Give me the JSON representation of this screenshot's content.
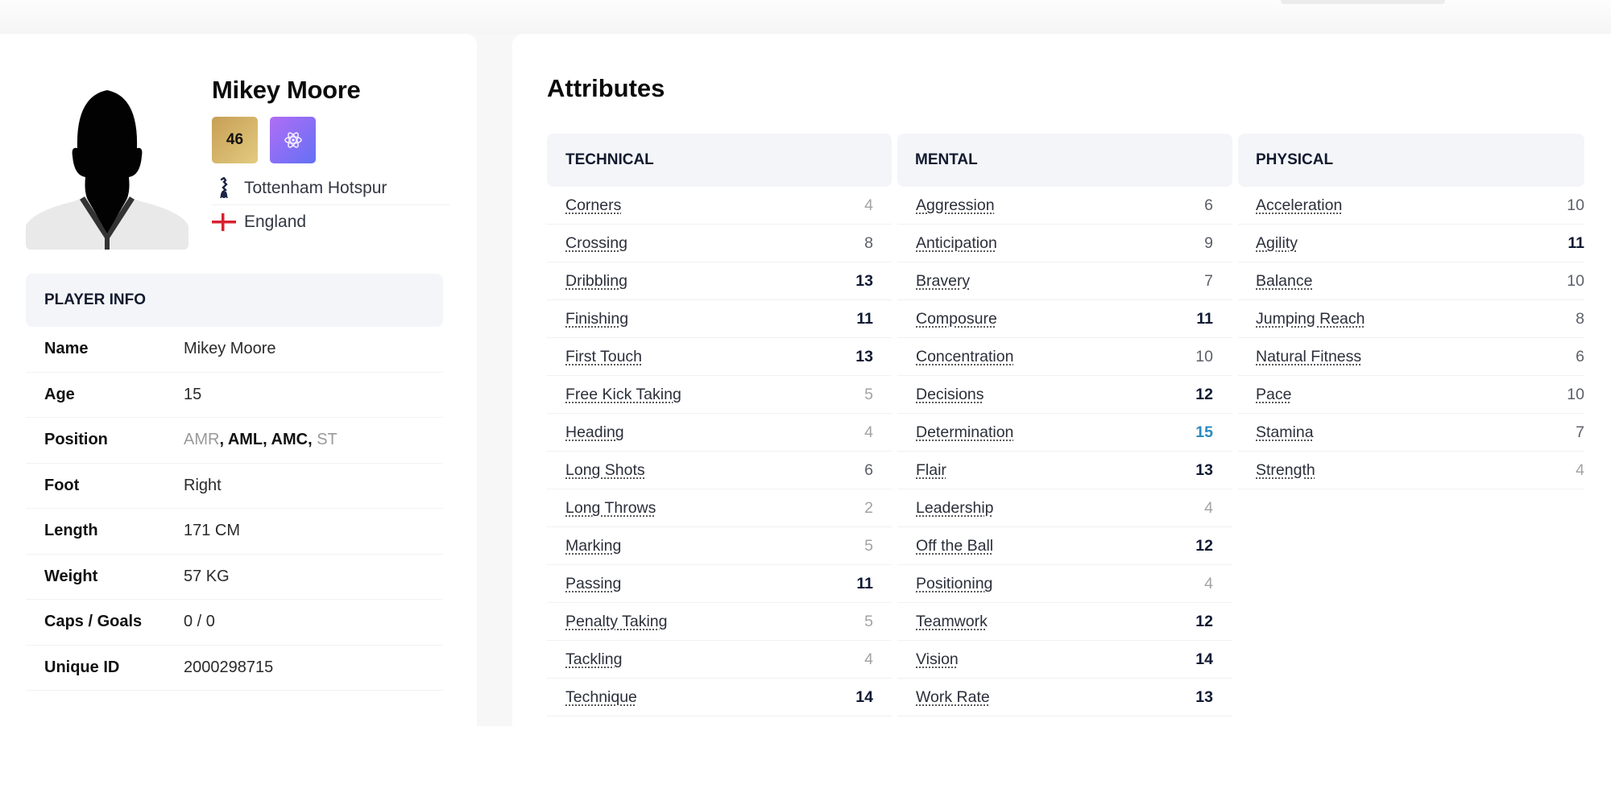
{
  "player": {
    "name": "Mikey Moore",
    "current_ability": "46",
    "potential_icon": "atom-icon",
    "club": "Tottenham Hotspur",
    "club_icon": "spurs-cockerel-icon",
    "nationality": "England",
    "nationality_icon": "england-flag-icon"
  },
  "player_info": {
    "heading": "PLAYER INFO",
    "rows": [
      {
        "label": "Name",
        "value": "Mikey Moore"
      },
      {
        "label": "Age",
        "value": "15"
      },
      {
        "label": "Position",
        "value": "AMR, AML, AMC, ST",
        "positions": [
          {
            "code": "AMR",
            "strength": "weak"
          },
          {
            "code": "AML",
            "strength": "strong"
          },
          {
            "code": "AMC",
            "strength": "strong"
          },
          {
            "code": "ST",
            "strength": "weak"
          }
        ]
      },
      {
        "label": "Foot",
        "value": "Right"
      },
      {
        "label": "Length",
        "value": "171 CM"
      },
      {
        "label": "Weight",
        "value": "57 KG"
      },
      {
        "label": "Caps / Goals",
        "value": "0 / 0"
      },
      {
        "label": "Unique ID",
        "value": "2000298715"
      }
    ]
  },
  "attributes": {
    "title": "Attributes",
    "value_colors": {
      "low": "#a3a3a3",
      "mid": "#5d6069",
      "good": "#0f1a33",
      "great": "#2a8bbd"
    },
    "groups": [
      {
        "heading": "TECHNICAL",
        "items": [
          {
            "name": "Corners",
            "value": 4
          },
          {
            "name": "Crossing",
            "value": 8
          },
          {
            "name": "Dribbling",
            "value": 13
          },
          {
            "name": "Finishing",
            "value": 11
          },
          {
            "name": "First Touch",
            "value": 13
          },
          {
            "name": "Free Kick Taking",
            "value": 5
          },
          {
            "name": "Heading",
            "value": 4
          },
          {
            "name": "Long Shots",
            "value": 6
          },
          {
            "name": "Long Throws",
            "value": 2
          },
          {
            "name": "Marking",
            "value": 5
          },
          {
            "name": "Passing",
            "value": 11
          },
          {
            "name": "Penalty Taking",
            "value": 5
          },
          {
            "name": "Tackling",
            "value": 4
          },
          {
            "name": "Technique",
            "value": 14
          }
        ]
      },
      {
        "heading": "MENTAL",
        "items": [
          {
            "name": "Aggression",
            "value": 6
          },
          {
            "name": "Anticipation",
            "value": 9
          },
          {
            "name": "Bravery",
            "value": 7
          },
          {
            "name": "Composure",
            "value": 11
          },
          {
            "name": "Concentration",
            "value": 10
          },
          {
            "name": "Decisions",
            "value": 12
          },
          {
            "name": "Determination",
            "value": 15
          },
          {
            "name": "Flair",
            "value": 13
          },
          {
            "name": "Leadership",
            "value": 4
          },
          {
            "name": "Off the Ball",
            "value": 12
          },
          {
            "name": "Positioning",
            "value": 4
          },
          {
            "name": "Teamwork",
            "value": 12
          },
          {
            "name": "Vision",
            "value": 14
          },
          {
            "name": "Work Rate",
            "value": 13
          }
        ]
      },
      {
        "heading": "PHYSICAL",
        "items": [
          {
            "name": "Acceleration",
            "value": 10
          },
          {
            "name": "Agility",
            "value": 11
          },
          {
            "name": "Balance",
            "value": 10
          },
          {
            "name": "Jumping Reach",
            "value": 8
          },
          {
            "name": "Natural Fitness",
            "value": 6
          },
          {
            "name": "Pace",
            "value": 10
          },
          {
            "name": "Stamina",
            "value": 7
          },
          {
            "name": "Strength",
            "value": 4
          }
        ]
      }
    ]
  }
}
